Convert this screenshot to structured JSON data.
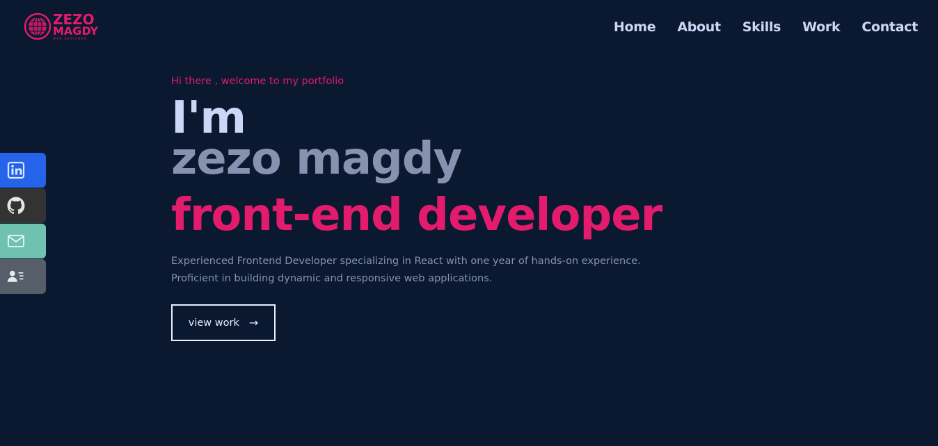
{
  "logo": {
    "line1": "ZEZO",
    "line2": "MAGDY",
    "tagline": "WEB DESIGNER"
  },
  "nav": {
    "items": [
      "Home",
      "About",
      "Skills",
      "Work",
      "Contact"
    ]
  },
  "hero": {
    "greeting": "Hi there , welcome to my portfolio",
    "intro": "I'm",
    "name": "zezo magdy",
    "role": "front-end developer",
    "description_line1": "Experienced Frontend Developer specializing in React with one year of hands-on experience.",
    "description_line2": "Proficient in building dynamic and responsive web applications.",
    "button_label": "view work",
    "button_arrow": "→"
  },
  "social": {
    "items": [
      {
        "icon": "linkedin-icon",
        "color": "#2563eb"
      },
      {
        "icon": "github-icon",
        "color": "#333333"
      },
      {
        "icon": "mail-icon",
        "color": "#6fc2b0"
      },
      {
        "icon": "resume-icon",
        "color": "#565f69"
      }
    ]
  },
  "colors": {
    "background": "#0a192f",
    "accent": "#e31b6d",
    "heading_light": "#ccd6f6",
    "heading_muted": "#8892b0"
  }
}
